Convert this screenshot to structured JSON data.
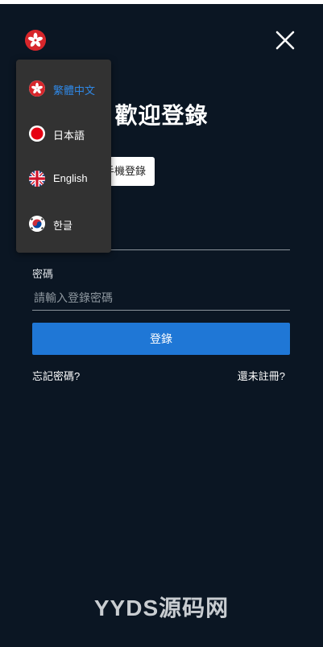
{
  "page": {
    "title": "歡迎登錄"
  },
  "header": {
    "flag_icon": "hong-kong-flag-icon",
    "close_icon": "close-icon"
  },
  "tabs": {
    "phone_label": "手機登錄"
  },
  "form": {
    "password_label": "密碼",
    "password_placeholder": "請輸入登錄密碼",
    "login_label": "登錄"
  },
  "links": {
    "forgot": "忘記密碼?",
    "register": "還未註冊?"
  },
  "language_menu": {
    "items": [
      {
        "label": "繁體中文",
        "icon": "hong-kong-flag-icon",
        "selected": true
      },
      {
        "label": "日本語",
        "icon": "japan-flag-icon",
        "selected": false
      },
      {
        "label": "English",
        "icon": "uk-flag-icon",
        "selected": false
      },
      {
        "label": "한글",
        "icon": "korea-flag-icon",
        "selected": false
      }
    ]
  },
  "watermark": {
    "text": "YYDS源码网"
  },
  "colors": {
    "background": "#0b1623",
    "primary": "#1f77d6",
    "menu_bg": "#323232",
    "selected_text": "#2f88e6"
  }
}
